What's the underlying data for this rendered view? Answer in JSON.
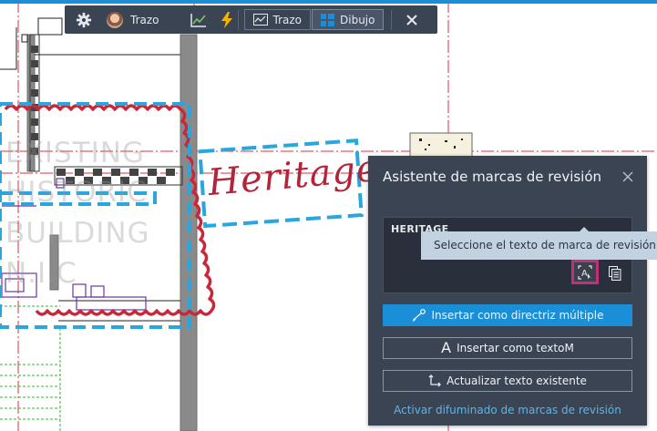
{
  "toolbar": {
    "settings_icon": "gear-icon",
    "user_name": "Trazo",
    "chart_icon": "trend-chart-icon",
    "bolt_icon": "lightning-icon",
    "tab_trazo": "Trazo",
    "tab_dibujo": "Dibujo",
    "close_icon": "close-icon"
  },
  "drawing": {
    "markup_text": "Heritage",
    "watermark_lines": [
      "EXISTING",
      "HISTORIC",
      "BUILDING",
      "N.I.C"
    ]
  },
  "panel": {
    "title": "Asistente de marcas de revisión",
    "extracted_text": "HERITAGE",
    "tooltip": "Seleccione el texto de marca de revisión o",
    "insert_multileader": "Insertar como directriz múltiple",
    "insert_mtext": "Insertar como textoM",
    "update_text": "Actualizar texto existente",
    "activate_fade": "Activar difuminado de marcas de revisión"
  },
  "colors": {
    "accent": "#1a8fd8",
    "panel_bg": "#3b4453",
    "highlight": "#c1307a",
    "revision_cloud": "#c8283a",
    "markup_box": "#29a6de"
  }
}
